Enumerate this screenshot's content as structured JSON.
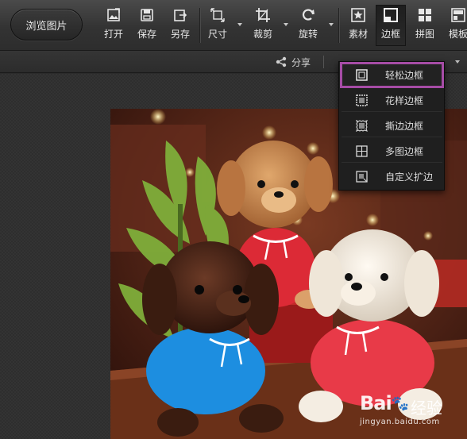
{
  "toolbar": {
    "browse_label": "浏览图片",
    "tools": [
      {
        "key": "open",
        "label": "打开",
        "icon": "open-image-icon"
      },
      {
        "key": "save",
        "label": "保存",
        "icon": "save-icon"
      },
      {
        "key": "saveas",
        "label": "另存",
        "icon": "save-as-icon"
      },
      {
        "key": "size",
        "label": "尺寸",
        "icon": "resize-icon"
      },
      {
        "key": "crop",
        "label": "裁剪",
        "icon": "crop-icon"
      },
      {
        "key": "rotate",
        "label": "旋转",
        "icon": "rotate-icon"
      },
      {
        "key": "material",
        "label": "素材",
        "icon": "star-sticker-icon"
      },
      {
        "key": "border",
        "label": "边框",
        "icon": "frame-icon"
      },
      {
        "key": "collage",
        "label": "拼图",
        "icon": "grid-collage-icon"
      },
      {
        "key": "template",
        "label": "模板",
        "icon": "template-icon"
      }
    ]
  },
  "subbar": {
    "share_label": "分享"
  },
  "border_menu": {
    "items": [
      {
        "label": "轻松边框",
        "icon": "simple-frame-icon",
        "highlighted": true
      },
      {
        "label": "花样边框",
        "icon": "pattern-frame-icon"
      },
      {
        "label": "撕边边框",
        "icon": "torn-edge-frame-icon"
      },
      {
        "label": "多图边框",
        "icon": "multi-photo-frame-icon"
      },
      {
        "label": "自定义扩边",
        "icon": "custom-extend-icon"
      }
    ]
  },
  "watermark": {
    "brand": "Bai",
    "paw": "🐾",
    "brand_tail": "",
    "experience": "经验",
    "url": "jingyan.baidu.com"
  },
  "colors": {
    "menu_highlight": "#a64ca6",
    "toolbar_bg": "#3a3a3a",
    "canvas_bg": "#2e2e2e"
  }
}
